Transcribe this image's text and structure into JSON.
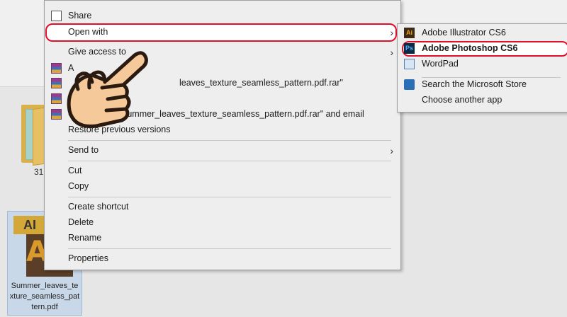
{
  "explorer": {
    "folder_label": "31",
    "file": {
      "icon_text": "AI",
      "icon_letter": "A",
      "name": "Summer_leaves_texture_seamless_pattern.pdf"
    }
  },
  "menu": {
    "items": [
      {
        "label": "Share",
        "icon": "share-icon"
      },
      {
        "label": "Open with",
        "icon": null
      },
      {
        "label": "Give access to",
        "icon": null
      },
      {
        "label": "A",
        "icon": "winrar-icon"
      },
      {
        "label": "leaves_texture_seamless_pattern.pdf.rar\"",
        "icon": "winrar-icon"
      },
      {
        "label": "",
        "icon": "winrar-icon"
      },
      {
        "label": "Co",
        "icon": "winrar-icon"
      },
      {
        "label": "Summer_leaves_texture_seamless_pattern.pdf.rar\" and email",
        "icon": null
      },
      {
        "label": "Restore previous versions",
        "icon": null
      },
      {
        "label": "Send to",
        "icon": null
      },
      {
        "label": "Cut",
        "icon": null
      },
      {
        "label": "Copy",
        "icon": null
      },
      {
        "label": "Create shortcut",
        "icon": null
      },
      {
        "label": "Delete",
        "icon": null
      },
      {
        "label": "Rename",
        "icon": null
      },
      {
        "label": "Properties",
        "icon": null
      }
    ],
    "arrow_glyph": "›"
  },
  "submenu": {
    "items": [
      {
        "label": "Adobe Illustrator CS6",
        "icon": "illustrator-icon",
        "icon_text": "Ai"
      },
      {
        "label": "Adobe Photoshop CS6",
        "icon": "photoshop-icon",
        "icon_text": "Ps"
      },
      {
        "label": "WordPad",
        "icon": "wordpad-icon",
        "icon_text": ""
      },
      {
        "label": "Search the Microsoft Store",
        "icon": "store-icon",
        "icon_text": ""
      },
      {
        "label": "Choose another app",
        "icon": null,
        "icon_text": ""
      }
    ]
  },
  "colors": {
    "highlight_border": "#e0102b",
    "hand_fill": "#f5c99a"
  }
}
